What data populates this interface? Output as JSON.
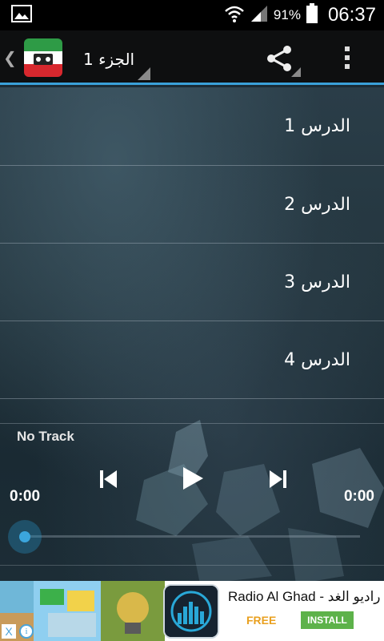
{
  "status_bar": {
    "battery_percent": "91%",
    "time": "06:37",
    "icons": [
      "image-icon",
      "wifi-icon",
      "signal-icon",
      "battery-icon"
    ]
  },
  "action_bar": {
    "back_glyph": "❮",
    "title": "الجزء 1",
    "icons": [
      "app-logo-icon",
      "share-icon",
      "overflow-menu-icon"
    ],
    "accent_color": "#3aa0d9"
  },
  "lessons": [
    {
      "label": "الدرس 1"
    },
    {
      "label": "الدرس 2"
    },
    {
      "label": "الدرس 3"
    },
    {
      "label": "الدرس 4"
    }
  ],
  "player": {
    "track": "No Track",
    "elapsed": "0:00",
    "duration": "0:00",
    "progress": 0,
    "controls": [
      "previous-icon",
      "play-icon",
      "next-icon"
    ]
  },
  "ad": {
    "title": "Radio Al Ghad - راديو الغد",
    "price": "FREE",
    "install_label": "INSTALL",
    "close_glyph": "X",
    "info_glyph": "i",
    "install_color": "#5db24a",
    "price_color": "#e9a01f"
  }
}
